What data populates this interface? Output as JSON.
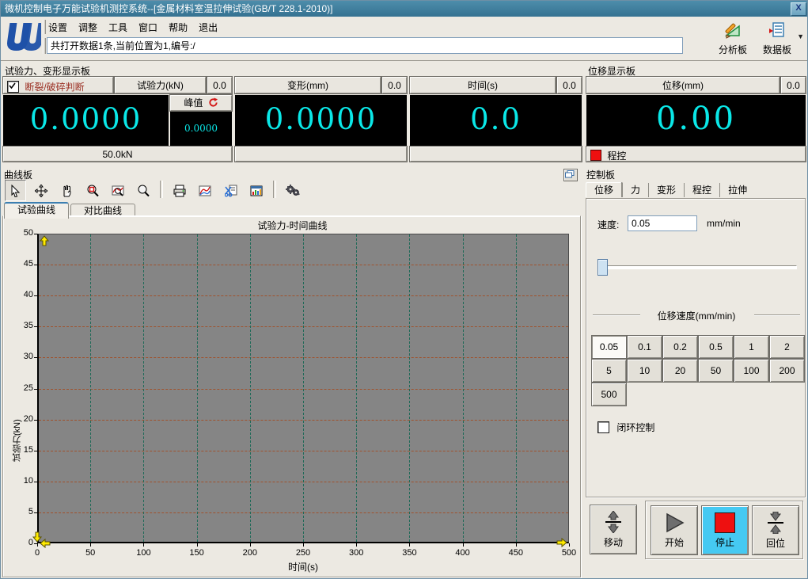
{
  "window": {
    "title": "微机控制电子万能试验机测控系统--[金属材料室温拉伸试验(GB/T 228.1-2010)]",
    "close_glyph": "X"
  },
  "menu": {
    "items": [
      "设置",
      "调整",
      "工具",
      "窗口",
      "帮助",
      "退出"
    ]
  },
  "status": {
    "text": "共打开数据1条,当前位置为1,编号:/"
  },
  "toolbar": {
    "analysis_label": "分析板",
    "data_label": "数据板",
    "dropdown_glyph": "▼"
  },
  "display": {
    "caption": "试验力、变形显示板",
    "break_label": "断裂/破碎判断",
    "break_checked": true,
    "force": {
      "name": "试验力(kN)",
      "aux": "0.0",
      "value": "0.0000",
      "peak_label": "峰值",
      "peak_value": "0.0000",
      "range": "50.0kN"
    },
    "deform": {
      "name": "变形(mm)",
      "aux": "0.0",
      "value": "0.0000"
    },
    "time": {
      "name": "时间(s)",
      "aux": "0.0",
      "value": "0.0"
    }
  },
  "displacement": {
    "caption": "位移显示板",
    "name": "位移(mm)",
    "aux": "0.0",
    "value": "0.00",
    "mode": "程控"
  },
  "curve": {
    "caption": "曲线板",
    "tabs": [
      {
        "label": "试验曲线",
        "active": true
      },
      {
        "label": "对比曲线",
        "active": false
      }
    ],
    "tools": [
      "cursor-tool",
      "move-tool",
      "pan-tool",
      "zoom-area-tool",
      "zoom-curve-tool",
      "zoom-tool",
      "print",
      "curve-style",
      "snip",
      "data-window",
      "gears"
    ]
  },
  "chart_data": {
    "type": "line",
    "title": "试验力-时间曲线",
    "xlabel": "时间(s)",
    "ylabel": "试验力(kN)",
    "xlim": [
      0,
      500
    ],
    "ylim": [
      0,
      50
    ],
    "xtick_step": 50,
    "ytick_step": 5,
    "grid": true,
    "series": [],
    "plot_bg": "#858585",
    "hgrid_color": "#A0522D",
    "vgrid_color": "#1F6A58"
  },
  "control": {
    "caption": "控制板",
    "tabs": [
      {
        "label": "位移",
        "active": true
      },
      {
        "label": "力",
        "active": false
      },
      {
        "label": "变形",
        "active": false
      },
      {
        "label": "程控",
        "active": false
      },
      {
        "label": "拉伸",
        "active": false
      }
    ],
    "speed_label": "速度:",
    "speed_value": "0.05",
    "speed_unit": "mm/min",
    "group_label": "位移速度(mm/min)",
    "speed_options": [
      "0.05",
      "0.1",
      "0.2",
      "0.5",
      "1",
      "2",
      "5",
      "10",
      "20",
      "50",
      "100",
      "200",
      "500"
    ],
    "active_speed": "0.05",
    "closed_loop_label": "闭环控制",
    "closed_loop_checked": false,
    "actions": {
      "move": "移动",
      "start": "开始",
      "stop": "停止",
      "home": "回位"
    }
  }
}
